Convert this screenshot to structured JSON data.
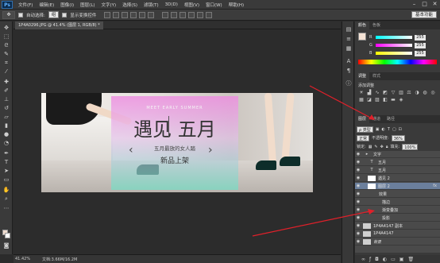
{
  "menu": {
    "logo": "Ps",
    "items": [
      "文件(F)",
      "编辑(E)",
      "图像(I)",
      "图层(L)",
      "文字(Y)",
      "选择(S)",
      "滤镜(T)",
      "3D(D)",
      "视图(V)",
      "窗口(W)",
      "帮助(H)"
    ],
    "minimize": "–",
    "maximize": "□",
    "close": "✕"
  },
  "options": {
    "auto_select_label": "自动选择:",
    "auto_select_value": "组",
    "show_transform_label": "显示变换控件",
    "workspace": "基本功能"
  },
  "document": {
    "tab_label": "1P4A0296.JPG @ 41.4% (图层 1, RGB/8) *",
    "zoom": "41.42%",
    "doc_info": "文档:3.66M/16.2M"
  },
  "banner": {
    "sub_en": "MEET EARLY SUMMER",
    "title": "遇见 五月",
    "subtitle": "五月最放的女人踏",
    "promo": "新品上架",
    "arrow_left": "‹",
    "arrow_right": "›"
  },
  "color_panel": {
    "tabs": [
      "颜色",
      "色板"
    ],
    "channels": [
      {
        "label": "R",
        "value": "255"
      },
      {
        "label": "G",
        "value": "255"
      },
      {
        "label": "B",
        "value": "255"
      }
    ],
    "fg_color": "#f5e3d5"
  },
  "adjust_panel": {
    "tabs": [
      "调整",
      "样式"
    ],
    "title": "添加调整"
  },
  "layers_panel": {
    "tabs": [
      "图层",
      "通道",
      "路径"
    ],
    "kind_filter": "ρ 类型",
    "blend_mode": "正常",
    "opacity_label": "不透明度:",
    "opacity_value": "36%",
    "lock_label": "锁定:",
    "fill_label": "填充:",
    "fill_value": "100%",
    "layers": [
      {
        "name": "文字",
        "thumb": "▸",
        "kind": "group",
        "visible": true
      },
      {
        "name": "五月",
        "thumb": "T",
        "kind": "text",
        "visible": true
      },
      {
        "name": "五月",
        "thumb": "T",
        "kind": "text",
        "visible": true
      },
      {
        "name": "遇见 2",
        "thumb": "",
        "kind": "shape",
        "visible": true
      },
      {
        "name": "图层 2",
        "thumb": "",
        "kind": "pixel",
        "visible": true,
        "selected": true,
        "fx": "fx"
      },
      {
        "name": "效果",
        "thumb": "",
        "kind": "effects",
        "visible": true
      },
      {
        "name": "描边",
        "thumb": "",
        "kind": "effect",
        "visible": true
      },
      {
        "name": "渐变叠加",
        "thumb": "",
        "kind": "effect",
        "visible": true
      },
      {
        "name": "投影",
        "thumb": "",
        "kind": "effect",
        "visible": true
      },
      {
        "name": "1P4A4147 副本",
        "thumb": "",
        "kind": "pixel",
        "visible": true
      },
      {
        "name": "1P4A4147",
        "thumb": "",
        "kind": "pixel",
        "visible": true
      },
      {
        "name": "背景",
        "thumb": "",
        "kind": "background",
        "visible": true
      }
    ]
  },
  "annotation_color": "#e0202a"
}
